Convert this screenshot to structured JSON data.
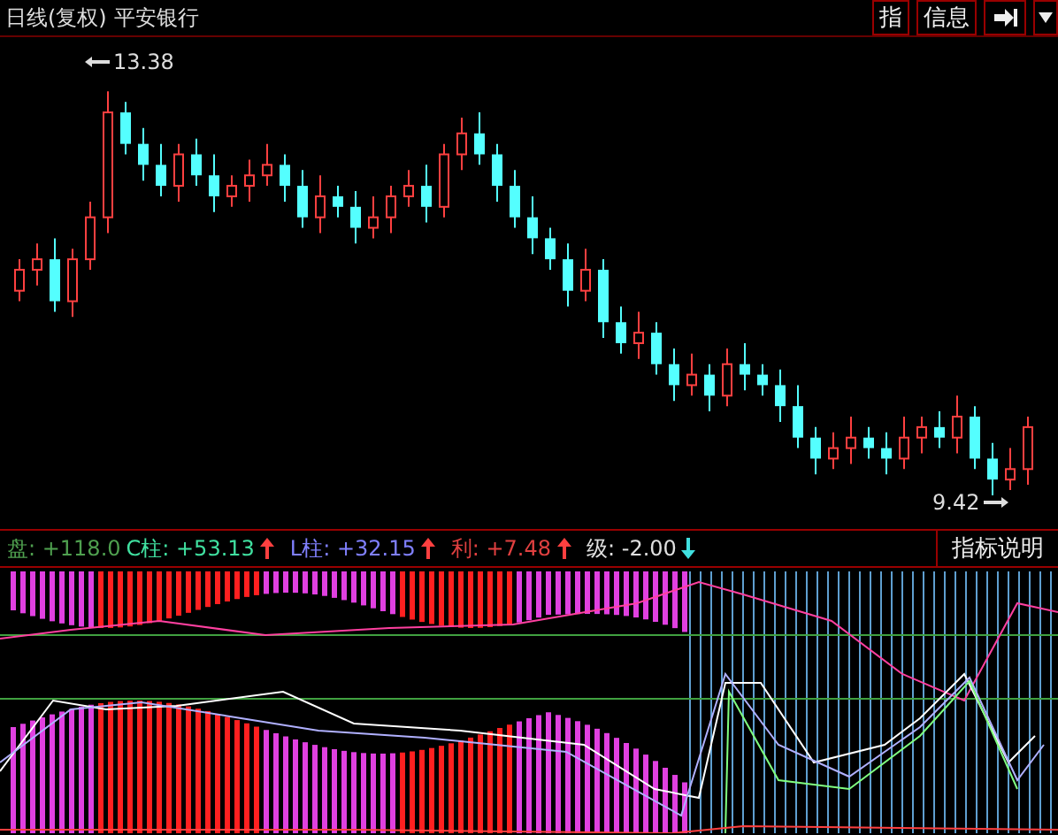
{
  "title_bar": {
    "period": "日线(复权)",
    "stock": "平安银行",
    "buttons": [
      "指",
      "信息"
    ]
  },
  "price_chart": {
    "high_label": "13.38",
    "low_label": "9.42"
  },
  "indicator": {
    "readings": [
      {
        "label": "盘:",
        "value": "+118.0",
        "color": "#4fa04f"
      },
      {
        "label": "C柱:",
        "value": "+53.13",
        "color": "#40e0a0",
        "rising": true
      },
      {
        "label": "L柱:",
        "value": "+32.15",
        "color": "#8080ff",
        "rising": true
      },
      {
        "label": "利:",
        "value": "+7.48",
        "color": "#e04040",
        "rising": true
      },
      {
        "label": "级:",
        "value": "-2.00",
        "color": "#e0e0e0",
        "rising": false
      }
    ],
    "help_button": "指标说明"
  }
}
